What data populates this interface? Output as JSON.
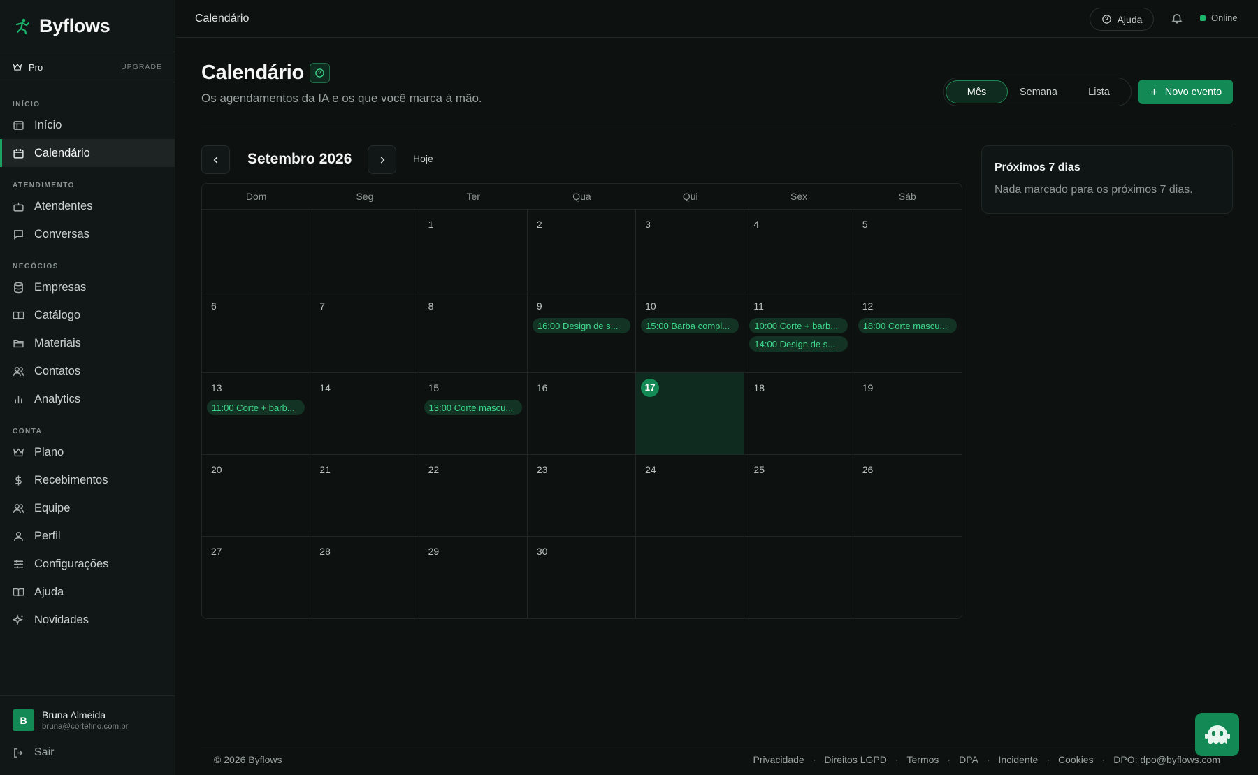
{
  "brand": {
    "name": "Byflows"
  },
  "plan": {
    "label": "Pro",
    "upgrade": "UPGRADE"
  },
  "sidebar": {
    "sections": [
      {
        "label": "INÍCIO",
        "items": [
          {
            "label": "Início",
            "icon": "layout-icon"
          },
          {
            "label": "Calendário",
            "icon": "calendar-icon",
            "active": true
          }
        ]
      },
      {
        "label": "ATENDIMENTO",
        "items": [
          {
            "label": "Atendentes",
            "icon": "bot-icon"
          },
          {
            "label": "Conversas",
            "icon": "chat-icon"
          }
        ]
      },
      {
        "label": "NEGÓCIOS",
        "items": [
          {
            "label": "Empresas",
            "icon": "database-icon"
          },
          {
            "label": "Catálogo",
            "icon": "book-icon"
          },
          {
            "label": "Materiais",
            "icon": "folder-icon"
          },
          {
            "label": "Contatos",
            "icon": "users-icon"
          },
          {
            "label": "Analytics",
            "icon": "bar-chart-icon"
          }
        ]
      },
      {
        "label": "CONTA",
        "items": [
          {
            "label": "Plano",
            "icon": "crown-icon"
          },
          {
            "label": "Recebimentos",
            "icon": "dollar-icon"
          },
          {
            "label": "Equipe",
            "icon": "team-icon"
          },
          {
            "label": "Perfil",
            "icon": "user-icon"
          },
          {
            "label": "Configurações",
            "icon": "sliders-icon"
          },
          {
            "label": "Ajuda",
            "icon": "help-book-icon"
          },
          {
            "label": "Novidades",
            "icon": "sparkles-icon"
          }
        ]
      }
    ]
  },
  "user": {
    "initial": "B",
    "name": "Bruna Almeida",
    "email": "bruna@cortefino.com.br"
  },
  "logout": "Sair",
  "topbar": {
    "crumb": "Calendário",
    "help": "Ajuda",
    "status": "Online",
    "status_color": "#1cb56c"
  },
  "page": {
    "title": "Calendário",
    "subtitle": "Os agendamentos da IA e os que você marca à mão.",
    "views": [
      "Mês",
      "Semana",
      "Lista"
    ],
    "selected_view": "Mês",
    "new_event": "Novo evento"
  },
  "calendar": {
    "month_label": "Setembro 2026",
    "today_label": "Hoje",
    "weekdays": [
      "Dom",
      "Seg",
      "Ter",
      "Qua",
      "Qui",
      "Sex",
      "Sáb"
    ],
    "today": 17,
    "weeks": [
      [
        null,
        null,
        1,
        2,
        3,
        4,
        5
      ],
      [
        6,
        7,
        8,
        9,
        10,
        11,
        12
      ],
      [
        13,
        14,
        15,
        16,
        17,
        18,
        19
      ],
      [
        20,
        21,
        22,
        23,
        24,
        25,
        26
      ],
      [
        27,
        28,
        29,
        30,
        null,
        null,
        null
      ]
    ],
    "events": {
      "9": [
        "16:00 Design de s..."
      ],
      "10": [
        "15:00 Barba compl..."
      ],
      "11": [
        "10:00 Corte + barb...",
        "14:00 Design de s..."
      ],
      "12": [
        "18:00 Corte mascu..."
      ],
      "13": [
        "11:00 Corte + barb..."
      ],
      "15": [
        "13:00 Corte mascu..."
      ]
    }
  },
  "upcoming": {
    "title": "Próximos 7 dias",
    "message": "Nada marcado para os próximos 7 dias."
  },
  "footer": {
    "copyright": "© 2026 Byflows",
    "links": [
      "Privacidade",
      "Direitos LGPD",
      "Termos",
      "DPA",
      "Incidente",
      "Cookies",
      "DPO: dpo@byflows.com"
    ]
  },
  "colors": {
    "accent": "#138a55",
    "event_bg": "#133324",
    "event_text": "#3fd98c",
    "background": "#0d1211"
  }
}
